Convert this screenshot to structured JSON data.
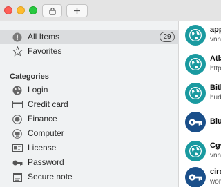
{
  "window": {
    "buttons": [
      {
        "name": "close",
        "color": "#fe5f57"
      },
      {
        "name": "minimize",
        "color": "#febc2e"
      },
      {
        "name": "zoom",
        "color": "#28c840"
      }
    ],
    "toolbar": {
      "lock_icon": "lock-icon",
      "add_icon": "plus-icon"
    }
  },
  "sidebar": {
    "all_items": {
      "label": "All Items",
      "count": "29",
      "icon": "all-items-icon"
    },
    "favorites": {
      "label": "Favorites",
      "icon": "star-icon"
    },
    "categories_header": "Categories",
    "categories": [
      {
        "label": "Login",
        "icon": "globe-icon"
      },
      {
        "label": "Credit card",
        "icon": "credit-card-icon"
      },
      {
        "label": "Finance",
        "icon": "finance-icon"
      },
      {
        "label": "Computer",
        "icon": "computer-icon"
      },
      {
        "label": "License",
        "icon": "license-icon"
      },
      {
        "label": "Password",
        "icon": "key-icon"
      },
      {
        "label": "Secure note",
        "icon": "note-icon"
      }
    ]
  },
  "items": [
    {
      "title": "app",
      "subtitle": "vnn",
      "type": "web"
    },
    {
      "title": "Atla",
      "subtitle": "http",
      "type": "web"
    },
    {
      "title": "Bitb",
      "subtitle": "hud",
      "type": "web"
    },
    {
      "title": "Blu",
      "subtitle": "",
      "type": "password"
    },
    {
      "title": "Cgv",
      "subtitle": "vnn",
      "type": "web"
    },
    {
      "title": "circ",
      "subtitle": "wor",
      "type": "password"
    }
  ],
  "colors": {
    "web": "#1a9aa0",
    "password": "#1a4f8a",
    "selection": "#dadcde"
  }
}
